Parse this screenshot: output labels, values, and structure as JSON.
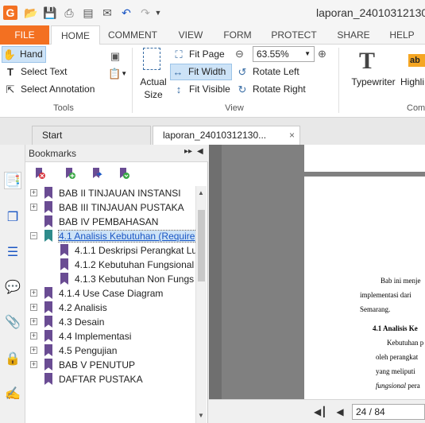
{
  "window": {
    "title": "laporan_24010312130"
  },
  "ribbon_tabs": [
    "FILE",
    "HOME",
    "COMMENT",
    "VIEW",
    "FORM",
    "PROTECT",
    "SHARE",
    "HELP"
  ],
  "tools_group": {
    "hand": "Hand",
    "select_text": "Select Text",
    "select_annotation": "Select Annotation",
    "label": "Tools"
  },
  "view_group": {
    "actual_size_line1": "Actual",
    "actual_size_line2": "Size",
    "fit_page": "Fit Page",
    "fit_width": "Fit Width",
    "fit_visible": "Fit Visible",
    "zoom": "63.55%",
    "rotate_left": "Rotate Left",
    "rotate_right": "Rotate Right",
    "label": "View"
  },
  "comment_group": {
    "typewriter": "Typewriter",
    "highlight": "Highli",
    "label": "Comm"
  },
  "doc_tabs": [
    "Start",
    "laporan_24010312130..."
  ],
  "bookmarks": {
    "title": "Bookmarks",
    "items": [
      {
        "label": "BAB II TINJAUAN INSTANSI",
        "level": 0,
        "expand": "+"
      },
      {
        "label": "BAB III TINJAUAN PUSTAKA",
        "level": 0,
        "expand": "+"
      },
      {
        "label": "BAB IV PEMBAHASAN",
        "level": 0,
        "expand": ""
      },
      {
        "label": "4.1 Analisis Kebutuhan (Require",
        "level": 0,
        "expand": "−"
      },
      {
        "label": "4.1.1 Deskripsi Perangkat Lu",
        "level": 1,
        "expand": ""
      },
      {
        "label": "4.1.2 Kebutuhan Fungsional",
        "level": 1,
        "expand": ""
      },
      {
        "label": "4.1.3 Kebutuhan Non Fungs",
        "level": 1,
        "expand": ""
      },
      {
        "label": "4.1.4 Use Case Diagram",
        "level": 0,
        "expand": "+"
      },
      {
        "label": "4.2 Analisis",
        "level": 0,
        "expand": "+"
      },
      {
        "label": "4.3 Desain",
        "level": 0,
        "expand": "+"
      },
      {
        "label": "4.4 Implementasi",
        "level": 0,
        "expand": "+"
      },
      {
        "label": "4.5 Pengujian",
        "level": 0,
        "expand": "+"
      },
      {
        "label": "BAB V PENUTUP",
        "level": 0,
        "expand": "+"
      },
      {
        "label": "DAFTAR PUSTAKA",
        "level": 0,
        "expand": ""
      }
    ]
  },
  "document_text": {
    "line1": "Bab ini menje",
    "line2": "implementasi  dari",
    "line3": "Semarang.",
    "heading": "4.1 Analisis Ke",
    "p1": "Kebutuhan p",
    "p2": "oleh perangkat",
    "p3": "yang meliputi",
    "p4_italic": "fungsional",
    "p4_rest": " pera"
  },
  "status": {
    "page": "24 / 84"
  }
}
